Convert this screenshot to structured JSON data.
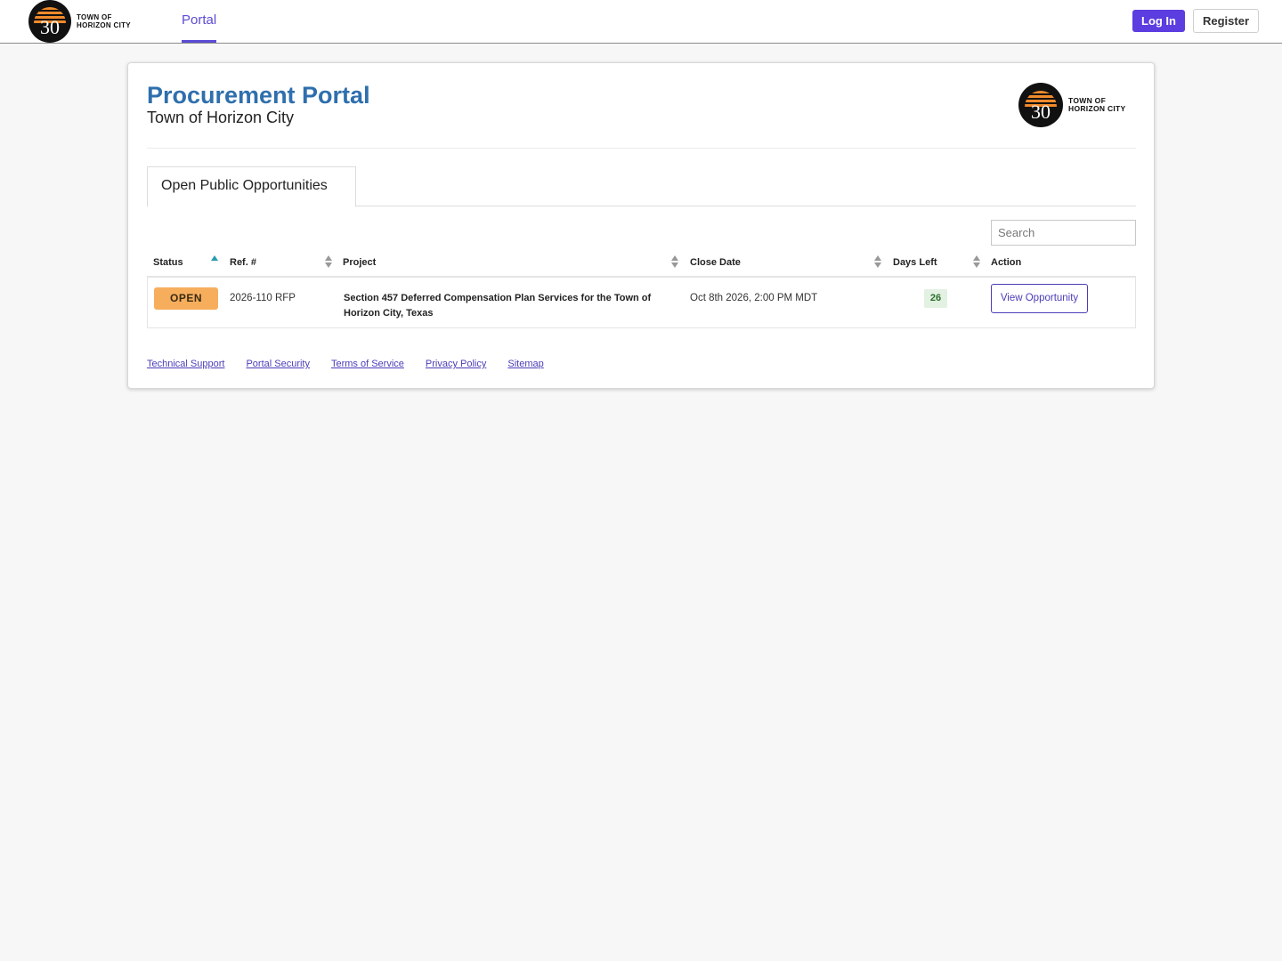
{
  "header": {
    "brand_line1": "TOWN OF",
    "brand_line2": "HORIZON CITY",
    "seal_number": "30",
    "nav_tab": "Portal",
    "login_label": "Log In",
    "register_label": "Register"
  },
  "portal": {
    "title": "Procurement Portal",
    "subtitle": "Town of Horizon City",
    "brand_line1": "TOWN OF",
    "brand_line2": "HORIZON CITY",
    "seal_number": "30"
  },
  "tabs": {
    "active": "Open Public Opportunities"
  },
  "search": {
    "placeholder": "Search"
  },
  "table": {
    "columns": [
      "Status",
      "Ref. #",
      "Project",
      "Close Date",
      "Days Left",
      "Action"
    ],
    "rows": [
      {
        "status": "OPEN",
        "ref": "2026-110 RFP",
        "project": "Section 457 Deferred Compensation Plan Services for the Town of Horizon City, Texas",
        "close_date": "Oct 8th 2026, 2:00 PM MDT",
        "days_left": "26",
        "action": "View Opportunity"
      }
    ]
  },
  "footer": {
    "links": [
      "Technical Support",
      "Portal Security",
      "Terms of Service",
      "Privacy Policy",
      "Sitemap"
    ]
  },
  "colors": {
    "accent": "#5b3de0",
    "title_blue": "#2f6fad",
    "status_open": "#f6ae5d",
    "days_bg": "#e2f1e2"
  }
}
